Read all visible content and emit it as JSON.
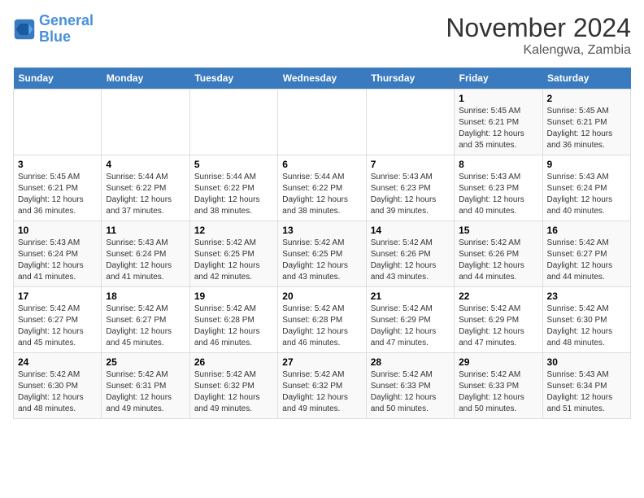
{
  "logo": {
    "line1": "General",
    "line2": "Blue"
  },
  "title": "November 2024",
  "subtitle": "Kalengwa, Zambia",
  "days_of_week": [
    "Sunday",
    "Monday",
    "Tuesday",
    "Wednesday",
    "Thursday",
    "Friday",
    "Saturday"
  ],
  "weeks": [
    [
      {
        "day": "",
        "info": ""
      },
      {
        "day": "",
        "info": ""
      },
      {
        "day": "",
        "info": ""
      },
      {
        "day": "",
        "info": ""
      },
      {
        "day": "",
        "info": ""
      },
      {
        "day": "1",
        "info": "Sunrise: 5:45 AM\nSunset: 6:21 PM\nDaylight: 12 hours and 35 minutes."
      },
      {
        "day": "2",
        "info": "Sunrise: 5:45 AM\nSunset: 6:21 PM\nDaylight: 12 hours and 36 minutes."
      }
    ],
    [
      {
        "day": "3",
        "info": "Sunrise: 5:45 AM\nSunset: 6:21 PM\nDaylight: 12 hours and 36 minutes."
      },
      {
        "day": "4",
        "info": "Sunrise: 5:44 AM\nSunset: 6:22 PM\nDaylight: 12 hours and 37 minutes."
      },
      {
        "day": "5",
        "info": "Sunrise: 5:44 AM\nSunset: 6:22 PM\nDaylight: 12 hours and 38 minutes."
      },
      {
        "day": "6",
        "info": "Sunrise: 5:44 AM\nSunset: 6:22 PM\nDaylight: 12 hours and 38 minutes."
      },
      {
        "day": "7",
        "info": "Sunrise: 5:43 AM\nSunset: 6:23 PM\nDaylight: 12 hours and 39 minutes."
      },
      {
        "day": "8",
        "info": "Sunrise: 5:43 AM\nSunset: 6:23 PM\nDaylight: 12 hours and 40 minutes."
      },
      {
        "day": "9",
        "info": "Sunrise: 5:43 AM\nSunset: 6:24 PM\nDaylight: 12 hours and 40 minutes."
      }
    ],
    [
      {
        "day": "10",
        "info": "Sunrise: 5:43 AM\nSunset: 6:24 PM\nDaylight: 12 hours and 41 minutes."
      },
      {
        "day": "11",
        "info": "Sunrise: 5:43 AM\nSunset: 6:24 PM\nDaylight: 12 hours and 41 minutes."
      },
      {
        "day": "12",
        "info": "Sunrise: 5:42 AM\nSunset: 6:25 PM\nDaylight: 12 hours and 42 minutes."
      },
      {
        "day": "13",
        "info": "Sunrise: 5:42 AM\nSunset: 6:25 PM\nDaylight: 12 hours and 43 minutes."
      },
      {
        "day": "14",
        "info": "Sunrise: 5:42 AM\nSunset: 6:26 PM\nDaylight: 12 hours and 43 minutes."
      },
      {
        "day": "15",
        "info": "Sunrise: 5:42 AM\nSunset: 6:26 PM\nDaylight: 12 hours and 44 minutes."
      },
      {
        "day": "16",
        "info": "Sunrise: 5:42 AM\nSunset: 6:27 PM\nDaylight: 12 hours and 44 minutes."
      }
    ],
    [
      {
        "day": "17",
        "info": "Sunrise: 5:42 AM\nSunset: 6:27 PM\nDaylight: 12 hours and 45 minutes."
      },
      {
        "day": "18",
        "info": "Sunrise: 5:42 AM\nSunset: 6:27 PM\nDaylight: 12 hours and 45 minutes."
      },
      {
        "day": "19",
        "info": "Sunrise: 5:42 AM\nSunset: 6:28 PM\nDaylight: 12 hours and 46 minutes."
      },
      {
        "day": "20",
        "info": "Sunrise: 5:42 AM\nSunset: 6:28 PM\nDaylight: 12 hours and 46 minutes."
      },
      {
        "day": "21",
        "info": "Sunrise: 5:42 AM\nSunset: 6:29 PM\nDaylight: 12 hours and 47 minutes."
      },
      {
        "day": "22",
        "info": "Sunrise: 5:42 AM\nSunset: 6:29 PM\nDaylight: 12 hours and 47 minutes."
      },
      {
        "day": "23",
        "info": "Sunrise: 5:42 AM\nSunset: 6:30 PM\nDaylight: 12 hours and 48 minutes."
      }
    ],
    [
      {
        "day": "24",
        "info": "Sunrise: 5:42 AM\nSunset: 6:30 PM\nDaylight: 12 hours and 48 minutes."
      },
      {
        "day": "25",
        "info": "Sunrise: 5:42 AM\nSunset: 6:31 PM\nDaylight: 12 hours and 49 minutes."
      },
      {
        "day": "26",
        "info": "Sunrise: 5:42 AM\nSunset: 6:32 PM\nDaylight: 12 hours and 49 minutes."
      },
      {
        "day": "27",
        "info": "Sunrise: 5:42 AM\nSunset: 6:32 PM\nDaylight: 12 hours and 49 minutes."
      },
      {
        "day": "28",
        "info": "Sunrise: 5:42 AM\nSunset: 6:33 PM\nDaylight: 12 hours and 50 minutes."
      },
      {
        "day": "29",
        "info": "Sunrise: 5:42 AM\nSunset: 6:33 PM\nDaylight: 12 hours and 50 minutes."
      },
      {
        "day": "30",
        "info": "Sunrise: 5:43 AM\nSunset: 6:34 PM\nDaylight: 12 hours and 51 minutes."
      }
    ]
  ]
}
